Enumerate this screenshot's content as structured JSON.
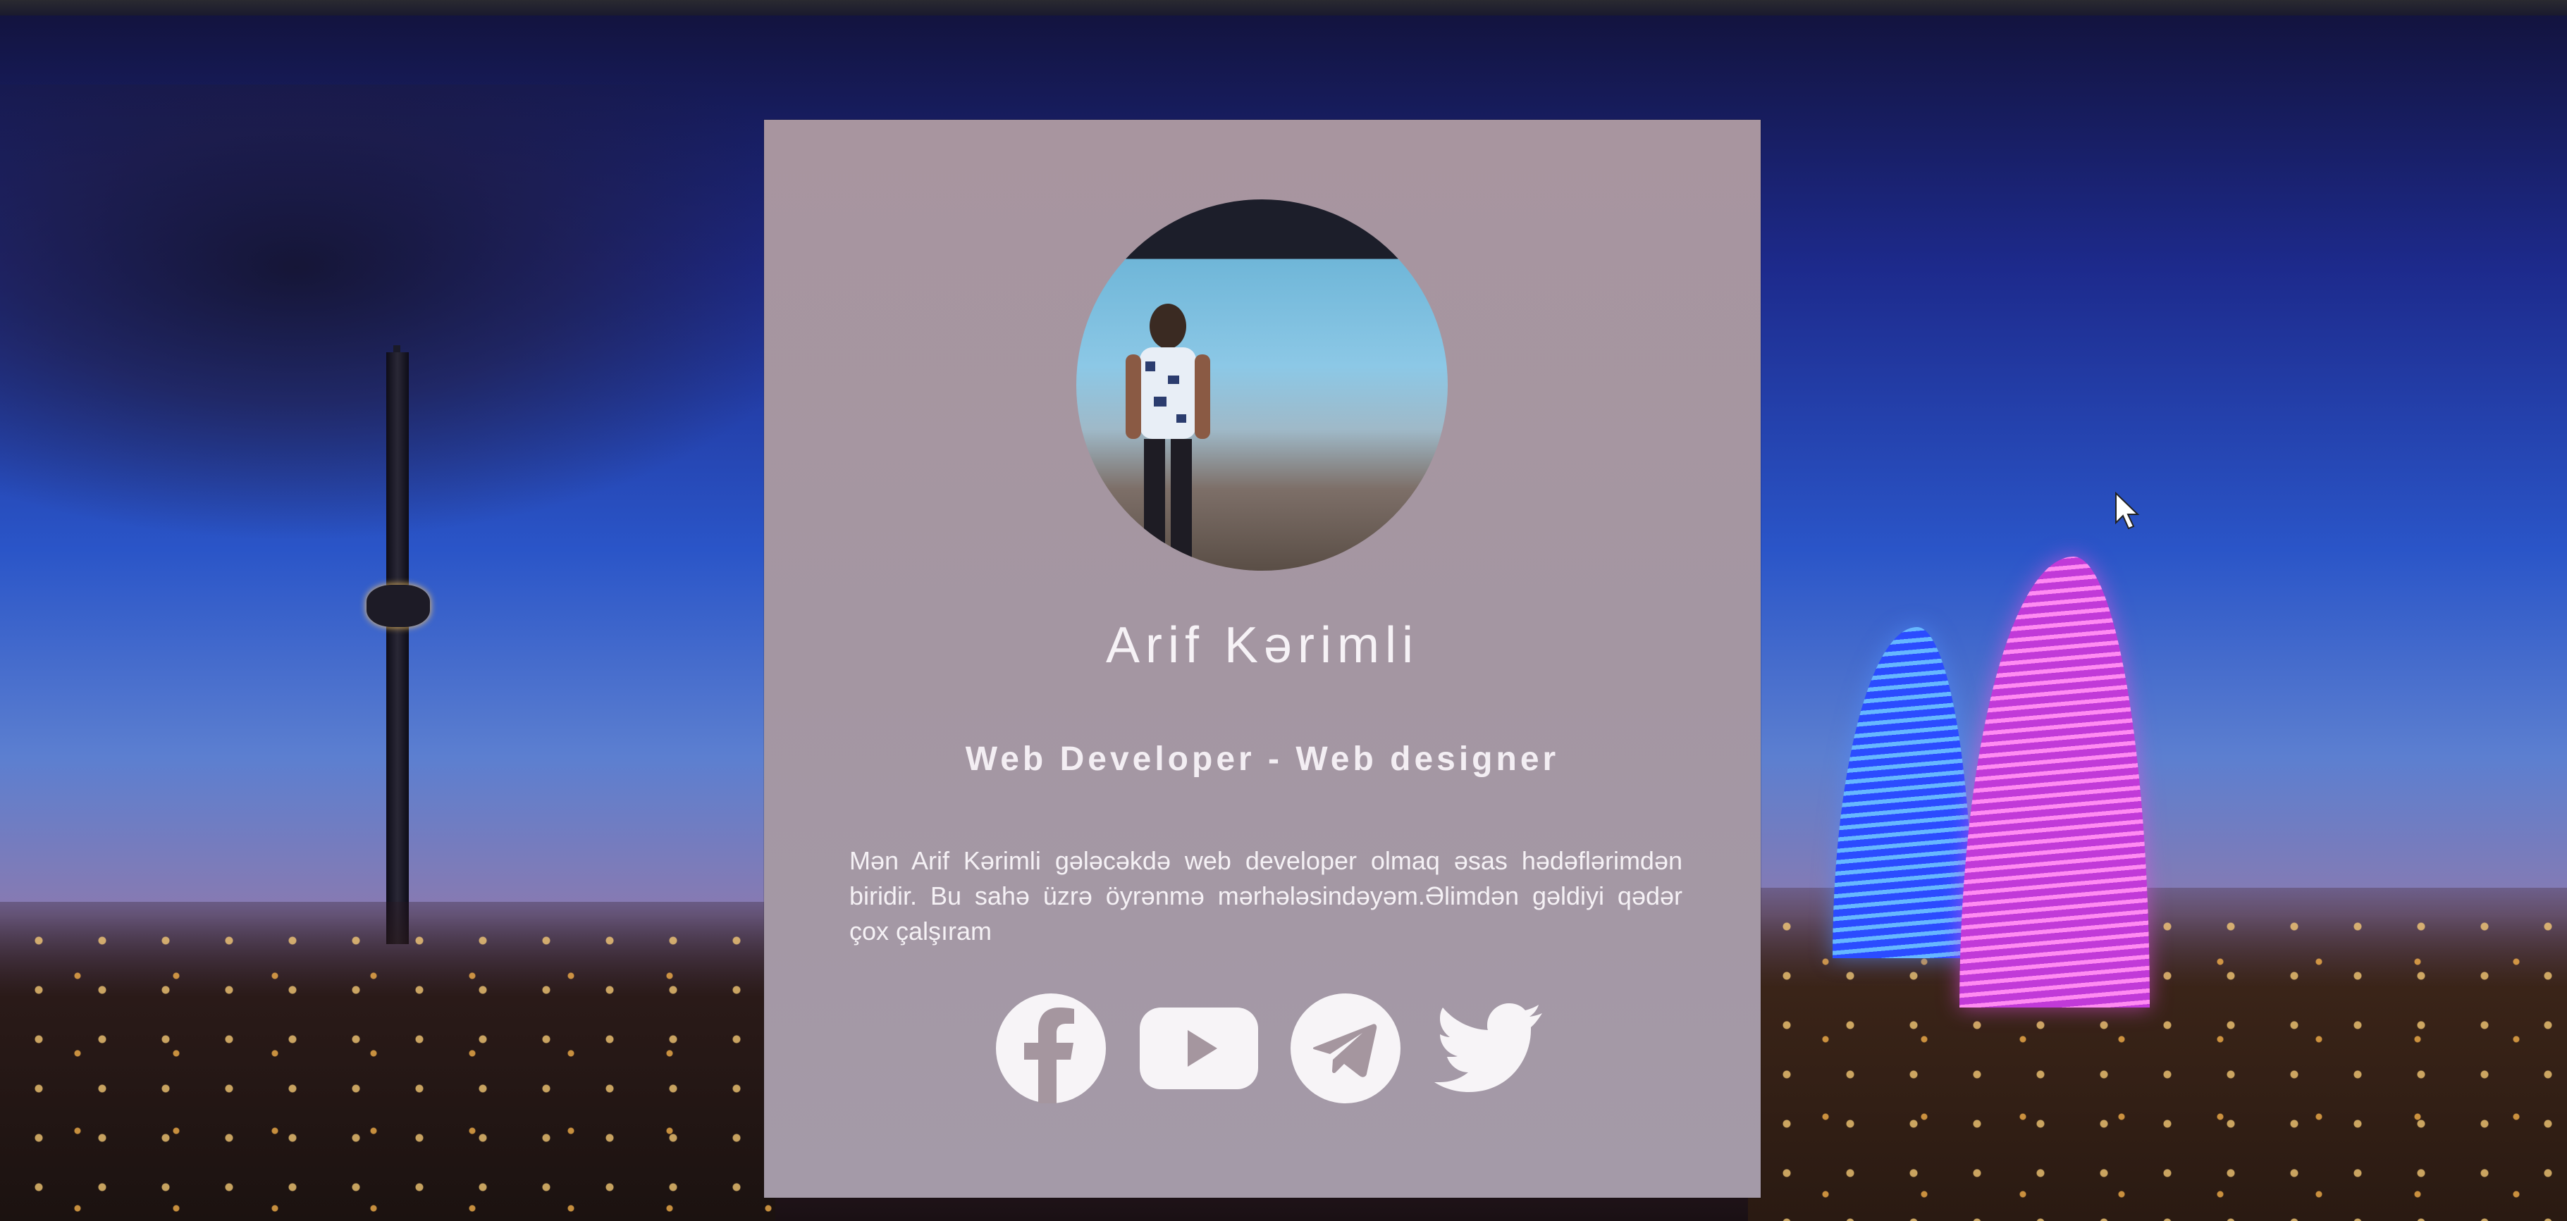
{
  "profile": {
    "name": "Arif Kərimli",
    "role": "Web Developer - Web designer",
    "bio": "Mən Arif Kərimli gələcəkdə web developer olmaq əsas hədəflərimdən biridir. Bu sahə üzrə öyrənmə mərhələsindəyəm.Əlimdən gəldiyi qədər çox çalşıram"
  },
  "social": [
    {
      "icon": "facebook-icon"
    },
    {
      "icon": "youtube-icon"
    },
    {
      "icon": "telegram-icon"
    },
    {
      "icon": "twitter-icon"
    }
  ],
  "colors": {
    "card": "#a8959f",
    "text": "#f6f2f6",
    "icon": "#f7f4f7",
    "icon_mark": "#a5969f"
  }
}
